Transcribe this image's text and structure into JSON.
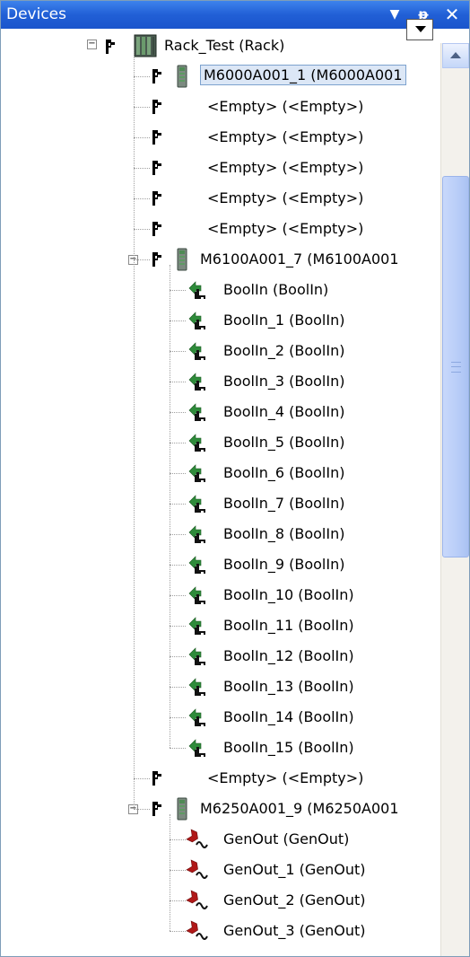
{
  "panel": {
    "title": "Devices"
  },
  "tree": {
    "rack": {
      "label": "Rack_Test (Rack)"
    },
    "rows": [
      {
        "type": "module",
        "label": "M6000A001_1 (M6000A001",
        "selected": true
      },
      {
        "type": "slot",
        "label": "<Empty> (<Empty>)"
      },
      {
        "type": "slot",
        "label": "<Empty> (<Empty>)"
      },
      {
        "type": "slot",
        "label": "<Empty> (<Empty>)"
      },
      {
        "type": "slot",
        "label": "<Empty> (<Empty>)"
      },
      {
        "type": "slot",
        "label": "<Empty> (<Empty>)"
      },
      {
        "type": "module",
        "label": "M6100A001_7 (M6100A001",
        "expanded": true
      },
      {
        "type": "boolin",
        "label": "BoolIn (BoolIn)"
      },
      {
        "type": "boolin",
        "label": "BoolIn_1 (BoolIn)"
      },
      {
        "type": "boolin",
        "label": "BoolIn_2 (BoolIn)"
      },
      {
        "type": "boolin",
        "label": "BoolIn_3 (BoolIn)"
      },
      {
        "type": "boolin",
        "label": "BoolIn_4 (BoolIn)"
      },
      {
        "type": "boolin",
        "label": "BoolIn_5 (BoolIn)"
      },
      {
        "type": "boolin",
        "label": "BoolIn_6 (BoolIn)"
      },
      {
        "type": "boolin",
        "label": "BoolIn_7 (BoolIn)"
      },
      {
        "type": "boolin",
        "label": "BoolIn_8 (BoolIn)"
      },
      {
        "type": "boolin",
        "label": "BoolIn_9 (BoolIn)"
      },
      {
        "type": "boolin",
        "label": "BoolIn_10 (BoolIn)"
      },
      {
        "type": "boolin",
        "label": "BoolIn_11 (BoolIn)"
      },
      {
        "type": "boolin",
        "label": "BoolIn_12 (BoolIn)"
      },
      {
        "type": "boolin",
        "label": "BoolIn_13 (BoolIn)"
      },
      {
        "type": "boolin",
        "label": "BoolIn_14 (BoolIn)"
      },
      {
        "type": "boolin",
        "label": "BoolIn_15 (BoolIn)"
      },
      {
        "type": "slot",
        "label": "<Empty> (<Empty>)"
      },
      {
        "type": "module",
        "label": "M6250A001_9 (M6250A001",
        "expanded": true
      },
      {
        "type": "genout",
        "label": "GenOut (GenOut)"
      },
      {
        "type": "genout",
        "label": "GenOut_1 (GenOut)"
      },
      {
        "type": "genout",
        "label": "GenOut_2 (GenOut)"
      },
      {
        "type": "genout",
        "label": "GenOut_3 (GenOut)"
      }
    ]
  },
  "icons": {
    "title_dropdown": "dropdown-arrow-icon",
    "title_pin": "pin-icon",
    "title_close": "close-icon",
    "rack": "rack-icon",
    "module": "io-module-icon",
    "slot": "empty-slot-icon",
    "boolin": "bool-input-icon",
    "genout": "gen-output-icon"
  },
  "colors": {
    "titlebar": "#215fd6",
    "selection": "#dce7f6",
    "input_arrow": "#2e8b3a",
    "output_arrow": "#b01818"
  }
}
